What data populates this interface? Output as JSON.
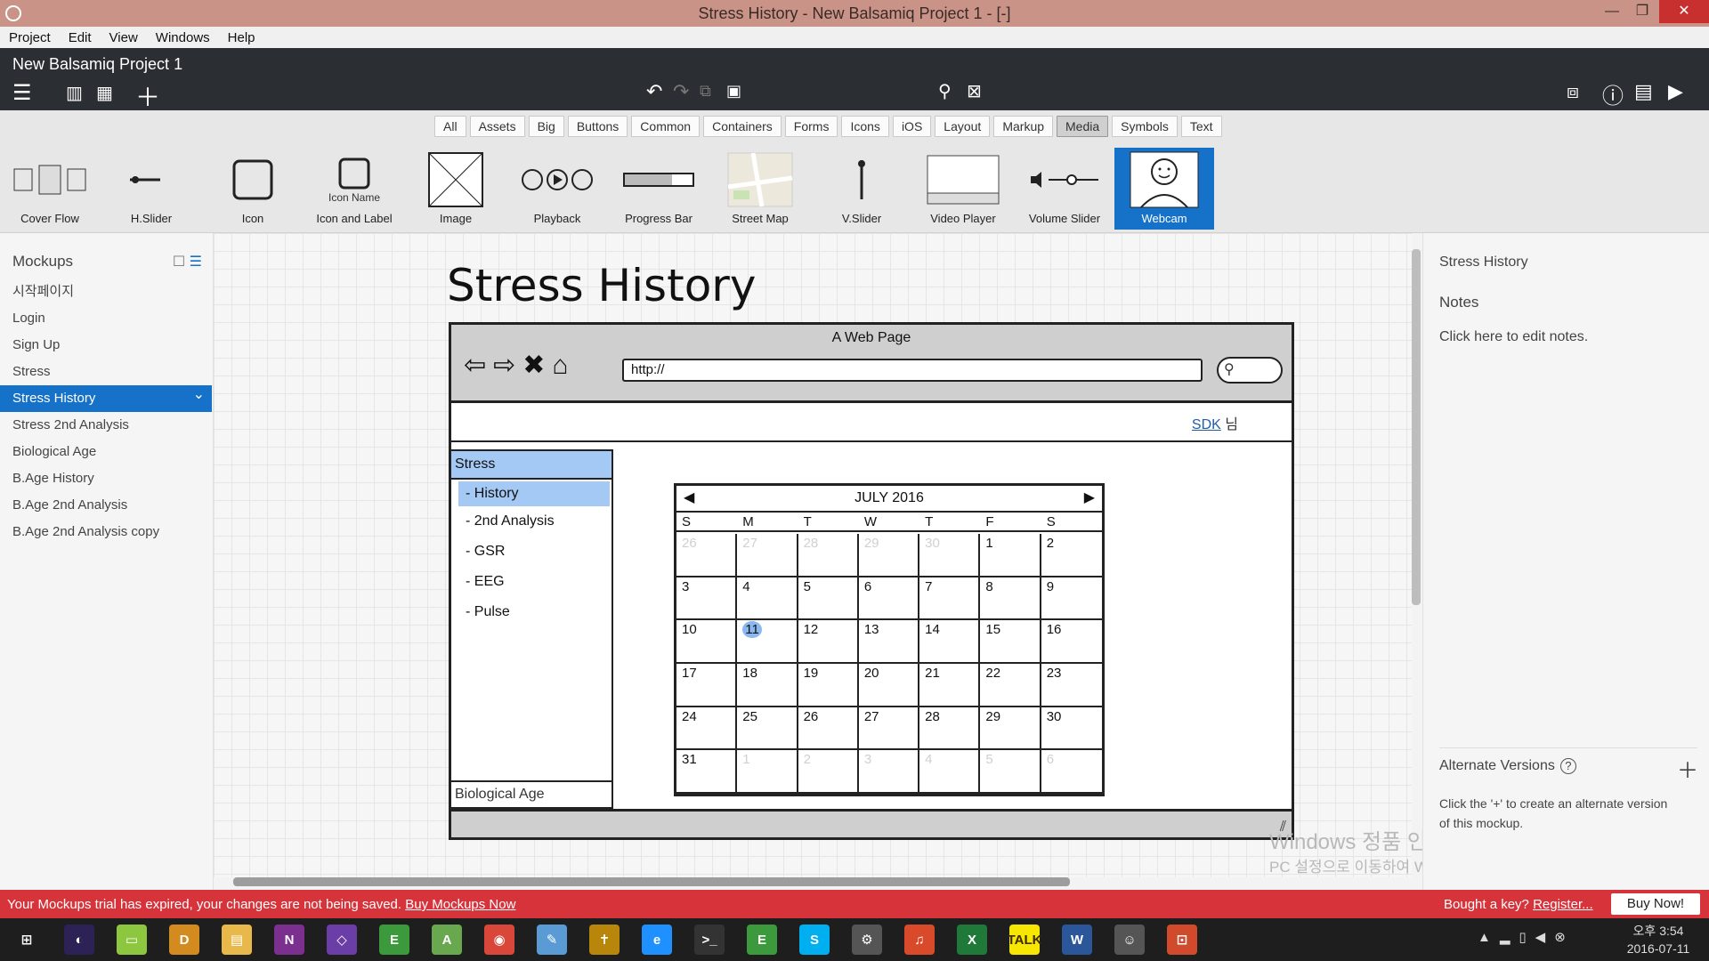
{
  "window": {
    "title": "Stress History - New Balsamiq Project 1 - [-]",
    "minimize": "—",
    "maximize": "❐",
    "close": "✕"
  },
  "menubar": {
    "items": [
      "Project",
      "Edit",
      "View",
      "Windows",
      "Help"
    ]
  },
  "toolbar": {
    "project_name": "New Balsamiq Project 1"
  },
  "filters": {
    "items": [
      "All",
      "Assets",
      "Big",
      "Buttons",
      "Common",
      "Containers",
      "Forms",
      "Icons",
      "iOS",
      "Layout",
      "Markup",
      "Media",
      "Symbols",
      "Text"
    ],
    "active": "Media"
  },
  "library": {
    "components": [
      {
        "label": "Cover Flow",
        "icon": "cover-flow-icon"
      },
      {
        "label": "H.Slider",
        "icon": "h-slider-icon"
      },
      {
        "label": "Icon",
        "icon": "icon-placeholder-icon"
      },
      {
        "label": "Icon and Label",
        "icon": "icon-and-label-icon",
        "sub": "Icon Name"
      },
      {
        "label": "Image",
        "icon": "image-icon"
      },
      {
        "label": "Playback",
        "icon": "playback-icon"
      },
      {
        "label": "Progress Bar",
        "icon": "progress-bar-icon",
        "progress_fraction": 0.7
      },
      {
        "label": "Street Map",
        "icon": "street-map-icon"
      },
      {
        "label": "V.Slider",
        "icon": "v-slider-icon"
      },
      {
        "label": "Video Player",
        "icon": "video-player-icon"
      },
      {
        "label": "Volume Slider",
        "icon": "volume-slider-icon"
      },
      {
        "label": "Webcam",
        "icon": "webcam-icon",
        "selected": true
      }
    ]
  },
  "mockups": {
    "header": "Mockups",
    "items": [
      "시작페이지",
      "Login",
      "Sign Up",
      "Stress",
      "Stress History",
      "Stress 2nd Analysis",
      "Biological Age",
      "B.Age History",
      "B.Age 2nd Analysis",
      "B.Age 2nd Analysis copy"
    ],
    "active": "Stress History"
  },
  "mockup": {
    "title": "Stress History",
    "browser": {
      "page_title": "A Web Page",
      "url": "http://",
      "user_link": "SDK",
      "user_suffix": "님"
    },
    "nav": {
      "header": "Stress",
      "items": [
        "- History",
        "- 2nd Analysis",
        "- GSR",
        "- EEG",
        "- Pulse"
      ],
      "selected": "- History",
      "bottom": "Biological Age"
    },
    "calendar": {
      "month": "JULY 2016",
      "dow": [
        "S",
        "M",
        "T",
        "W",
        "T",
        "F",
        "S"
      ],
      "days": [
        "26",
        "27",
        "28",
        "29",
        "30",
        "1",
        "2",
        "3",
        "4",
        "5",
        "6",
        "7",
        "8",
        "9",
        "10",
        "11",
        "12",
        "13",
        "14",
        "15",
        "16",
        "17",
        "18",
        "19",
        "20",
        "21",
        "22",
        "23",
        "24",
        "25",
        "26",
        "27",
        "28",
        "29",
        "30",
        "31",
        "1",
        "2",
        "3",
        "4",
        "5",
        "6"
      ],
      "muted_indices": [
        0,
        1,
        2,
        3,
        4,
        36,
        37,
        38,
        39,
        40,
        41
      ],
      "today_index": 15
    }
  },
  "rightpanel": {
    "title": "Stress History",
    "notes_label": "Notes",
    "notes_hint": "Click here to edit notes.",
    "alt_title": "Alternate Versions",
    "alt_help": "?",
    "alt_desc": "Click the '+' to create an alternate version of this mockup."
  },
  "watermark": {
    "line1": "Windows 정품 인증",
    "line2": "PC 설정으로 이동하여 Windows를 정품 인증합니다."
  },
  "trial": {
    "message": "Your Mockups trial has expired, your changes are not being saved.",
    "buy_link": "Buy Mockups Now",
    "key_text": "Bought a key?",
    "register_link": "Register...",
    "buy_button": "Buy Now!"
  },
  "taskbar": {
    "apps": [
      {
        "name": "start-icon",
        "color": "#1e1e1e",
        "glyph": "⊞"
      },
      {
        "name": "eclipse-icon",
        "color": "#2c2255",
        "glyph": "◐"
      },
      {
        "name": "notes-icon",
        "color": "#8dc63f",
        "glyph": "▭"
      },
      {
        "name": "viewer-icon",
        "color": "#d38b1f",
        "glyph": "D"
      },
      {
        "name": "explorer-icon",
        "color": "#e8b84a",
        "glyph": "▤"
      },
      {
        "name": "onenote-icon",
        "color": "#7b2f8f",
        "glyph": "N"
      },
      {
        "name": "visual-studio-icon",
        "color": "#6a3ea6",
        "glyph": "◇"
      },
      {
        "name": "evernote-icon",
        "color": "#3c9a3c",
        "glyph": "E"
      },
      {
        "name": "android-studio-icon",
        "color": "#6aa84f",
        "glyph": "A"
      },
      {
        "name": "chrome-icon",
        "color": "#d9473a",
        "glyph": "◉"
      },
      {
        "name": "pen-icon",
        "color": "#5b9bd5",
        "glyph": "✎"
      },
      {
        "name": "game-icon",
        "color": "#b8860b",
        "glyph": "✝"
      },
      {
        "name": "ie-icon",
        "color": "#1e90ff",
        "glyph": "e"
      },
      {
        "name": "terminal-icon",
        "color": "#333333",
        "glyph": ">_"
      },
      {
        "name": "evernote-2-icon",
        "color": "#3c9a3c",
        "glyph": "E"
      },
      {
        "name": "skype-icon",
        "color": "#00aff0",
        "glyph": "S"
      },
      {
        "name": "settings-icon",
        "color": "#555555",
        "glyph": "⚙"
      },
      {
        "name": "music-icon",
        "color": "#d94a2b",
        "glyph": "♫"
      },
      {
        "name": "excel-icon",
        "color": "#1f7a3a",
        "glyph": "X"
      },
      {
        "name": "kakaotalk-icon",
        "color": "#f7e600",
        "glyph": "TALK"
      },
      {
        "name": "word-icon",
        "color": "#2b579a",
        "glyph": "W"
      },
      {
        "name": "balsamiq-icon",
        "color": "#555555",
        "glyph": "☺"
      },
      {
        "name": "pdf-icon",
        "color": "#d04a2b",
        "glyph": "⊡"
      }
    ],
    "clock_ampm": "오후 3:54",
    "clock_date": "2016-07-11"
  }
}
